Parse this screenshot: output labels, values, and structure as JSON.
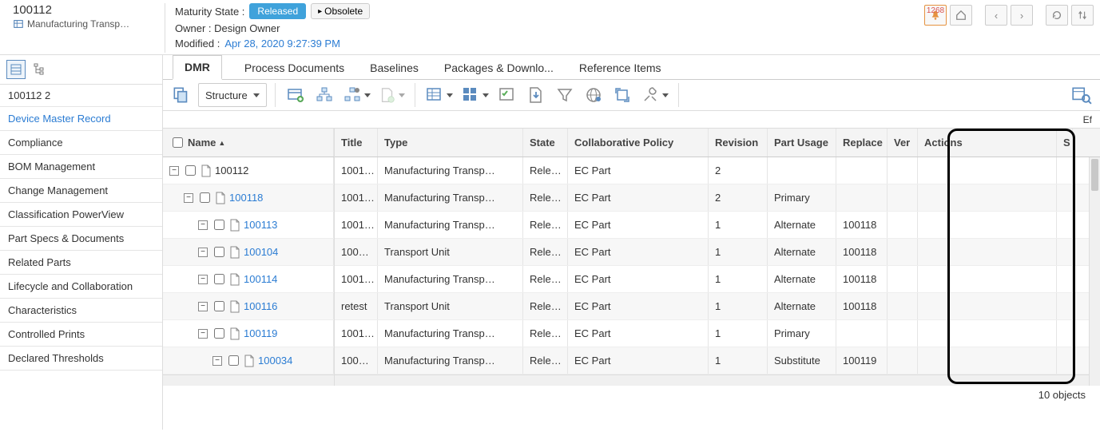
{
  "header": {
    "id": "100112",
    "type": "Manufacturing Transp…",
    "maturity_label": "Maturity State :",
    "maturity_state": "Released",
    "obsolete_label": "Obsolete",
    "owner_label": "Owner : Design Owner",
    "modified_label": "Modified :",
    "modified_date": "Apr 28, 2020 9:27:39 PM",
    "notif_count": "1268"
  },
  "nav": {
    "id": "100112 2",
    "items": [
      "Device Master Record",
      "Compliance",
      "BOM Management",
      "Change Management",
      "Classification PowerView",
      "Part Specs & Documents",
      "Related Parts",
      "Lifecycle and Collaboration",
      "Characteristics",
      "Controlled Prints",
      "Declared Thresholds"
    ],
    "active_index": 0
  },
  "tabs": {
    "items": [
      "DMR",
      "Process Documents",
      "Baselines",
      "Packages & Downlo...",
      "Reference Items"
    ],
    "active_index": 0
  },
  "toolbar": {
    "structure_label": "Structure"
  },
  "effectivity_label": "Ef",
  "columns": {
    "name": "Name",
    "title": "Title",
    "type": "Type",
    "state": "State",
    "policy": "Collaborative Policy",
    "revision": "Revision",
    "usage": "Part Usage",
    "replace": "Replace",
    "ver": "Ver",
    "actions": "Actions",
    "s": "S"
  },
  "rows": [
    {
      "depth": 0,
      "name": "100112",
      "link": false,
      "title": "1001…",
      "type": "Manufacturing Transp…",
      "state": "Rele…",
      "policy": "EC Part",
      "revision": "2",
      "usage": "",
      "replace": ""
    },
    {
      "depth": 1,
      "name": "100118",
      "link": true,
      "title": "1001…",
      "type": "Manufacturing Transp…",
      "state": "Rele…",
      "policy": "EC Part",
      "revision": "2",
      "usage": "Primary",
      "replace": ""
    },
    {
      "depth": 2,
      "name": "100113",
      "link": true,
      "title": "1001…",
      "type": "Manufacturing Transp…",
      "state": "Rele…",
      "policy": "EC Part",
      "revision": "1",
      "usage": "Alternate",
      "replace": "100118"
    },
    {
      "depth": 2,
      "name": "100104",
      "link": true,
      "title": "100…",
      "type": "Transport Unit",
      "state": "Rele…",
      "policy": "EC Part",
      "revision": "1",
      "usage": "Alternate",
      "replace": "100118"
    },
    {
      "depth": 2,
      "name": "100114",
      "link": true,
      "title": "1001…",
      "type": "Manufacturing Transp…",
      "state": "Rele…",
      "policy": "EC Part",
      "revision": "1",
      "usage": "Alternate",
      "replace": "100118"
    },
    {
      "depth": 2,
      "name": "100116",
      "link": true,
      "title": "retest",
      "type": "Transport Unit",
      "state": "Rele…",
      "policy": "EC Part",
      "revision": "1",
      "usage": "Alternate",
      "replace": "100118"
    },
    {
      "depth": 2,
      "name": "100119",
      "link": true,
      "title": "1001…",
      "type": "Manufacturing Transp…",
      "state": "Rele…",
      "policy": "EC Part",
      "revision": "1",
      "usage": "Primary",
      "replace": ""
    },
    {
      "depth": 3,
      "name": "100034",
      "link": true,
      "title": "100…",
      "type": "Manufacturing Transp…",
      "state": "Rele…",
      "policy": "EC Part",
      "revision": "1",
      "usage": "Substitute",
      "replace": "100119"
    }
  ],
  "footer": {
    "count": "10 objects"
  }
}
